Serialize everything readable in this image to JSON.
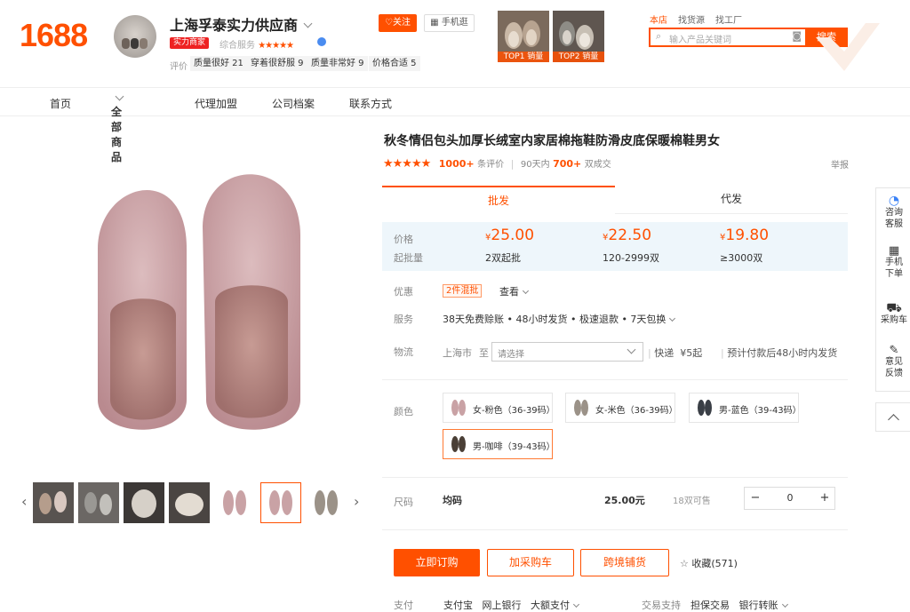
{
  "header": {
    "logo": "1688",
    "shop_name": "上海孚泰实力供应商",
    "badge": "实力商家",
    "service_label": "综合服务",
    "service_stars": "★★★★★",
    "review_label": "评价",
    "review_tags": [
      "质量很好 21",
      "穿着很舒服 9",
      "质量非常好 9",
      "价格合适 5"
    ],
    "follow_label": "关注",
    "mobile_label": "手机逛",
    "top_items": [
      {
        "label": "TOP1 销量"
      },
      {
        "label": "TOP2 销量"
      }
    ],
    "search_tabs": [
      "本店",
      "找货源",
      "找工厂"
    ],
    "search_placeholder": "输入产品关键词",
    "search_button": "搜索"
  },
  "nav": {
    "items": [
      "首页",
      "全部商品",
      "代理加盟",
      "公司档案",
      "联系方式"
    ]
  },
  "product": {
    "title": "秋冬情侣包头加厚长绒室内家居棉拖鞋防滑皮底保暖棉鞋男女",
    "rating_stars": "★★★★★",
    "review_count": "1000+",
    "review_suffix": "条评价",
    "sold_prefix": "90天内",
    "sold_count": "700+",
    "sold_suffix": "双成交",
    "report": "举报",
    "tabs": [
      "批发",
      "代发"
    ],
    "price_label": "价格",
    "moq_label": "起批量",
    "currency": "¥",
    "tiers": [
      {
        "price": "25.00",
        "qty": "2双起批"
      },
      {
        "price": "22.50",
        "qty": "120-2999双"
      },
      {
        "price": "19.80",
        "qty": "≥3000双"
      }
    ],
    "promo_label": "优惠",
    "promo_tag": "2件混批",
    "promo_view": "查看",
    "service_label": "服务",
    "service_text": "38天免费赊账 • 48小时发货 • 极速退款 • 7天包换",
    "logistics_label": "物流",
    "from_city": "上海市",
    "to_label": "至",
    "select_placeholder": "请选择",
    "express": "快递",
    "express_price": "¥5起",
    "ship_note": "预计付款后48小时内发货",
    "color_label": "颜色",
    "colors": [
      {
        "name": "女-粉色（36-39码）"
      },
      {
        "name": "女-米色（36-39码）"
      },
      {
        "name": "男-蓝色（39-43码）"
      },
      {
        "name": "男-咖啡（39-43码）"
      }
    ],
    "size_label": "尺码",
    "size_value": "均码",
    "size_price": "25.00元",
    "stock": "18双可售",
    "qty_value": "0",
    "qty_minus": "−",
    "qty_plus": "+",
    "buy_now": "立即订购",
    "add_cart": "加采购车",
    "cross_border": "跨境铺货",
    "favorite": "收藏(571)",
    "pay_label": "支付",
    "pay_methods": [
      "支付宝",
      "网上银行",
      "大额支付"
    ],
    "trade_label": "交易支持",
    "trade_methods": [
      "担保交易",
      "银行转账"
    ]
  },
  "sidebar": {
    "items": [
      "咨询客服",
      "手机下单",
      "采购车",
      "意见反馈"
    ]
  },
  "colors": {
    "accent": "#ff5000",
    "price": "#ff5000"
  }
}
